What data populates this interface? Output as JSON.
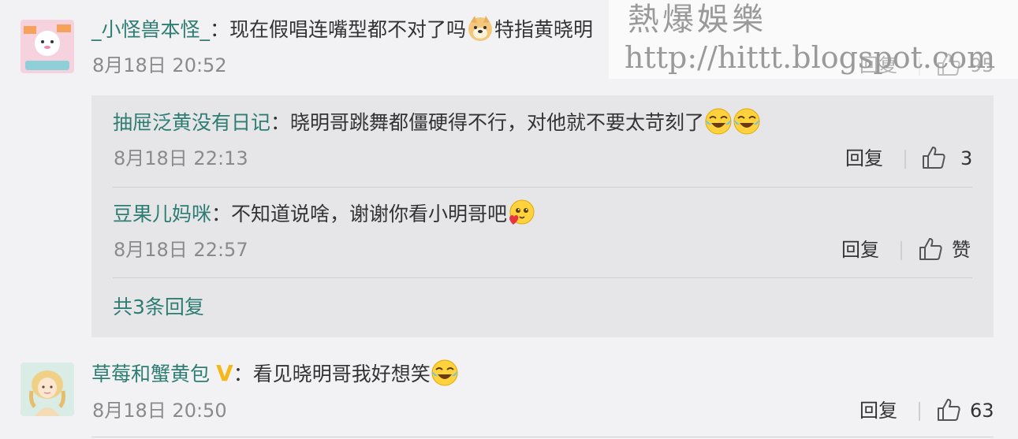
{
  "comments": [
    {
      "username": "_小怪兽本怪_",
      "separator": "：",
      "text": "现在假唱连嘴型都不对了吗",
      "emoji": "doge-icon",
      "text2": "特指黄晓明",
      "time": "8月18日 20:52",
      "reply_label": "回复",
      "likes": "95"
    },
    {
      "username": "草莓和蟹黄包",
      "verified": "V",
      "separator": "：",
      "text": "看见晓明哥我好想笑",
      "emoji": "laugh-cry-icon",
      "time": "8月18日 20:50",
      "reply_label": "回复",
      "likes": "63"
    }
  ],
  "replies": [
    {
      "username": "抽屉泛黄没有日记",
      "separator": "：",
      "text": "晓明哥跳舞都僵硬得不行，对他就不要太苛刻了",
      "emojis": [
        "laugh-cry-icon",
        "laugh-cry-icon"
      ],
      "time": "8月18日 22:13",
      "reply_label": "回复",
      "likes": "3"
    },
    {
      "username": "豆果儿妈咪",
      "separator": "：",
      "text": "不知道说啥，谢谢你看小明哥吧",
      "emoji": "heart-face-icon",
      "time": "8月18日 22:57",
      "reply_label": "回复",
      "likes": "赞"
    }
  ],
  "more_replies": "共3条回复",
  "watermark": {
    "line1": "熱爆娛樂",
    "line2": "http://hittt.blogspot.com"
  }
}
